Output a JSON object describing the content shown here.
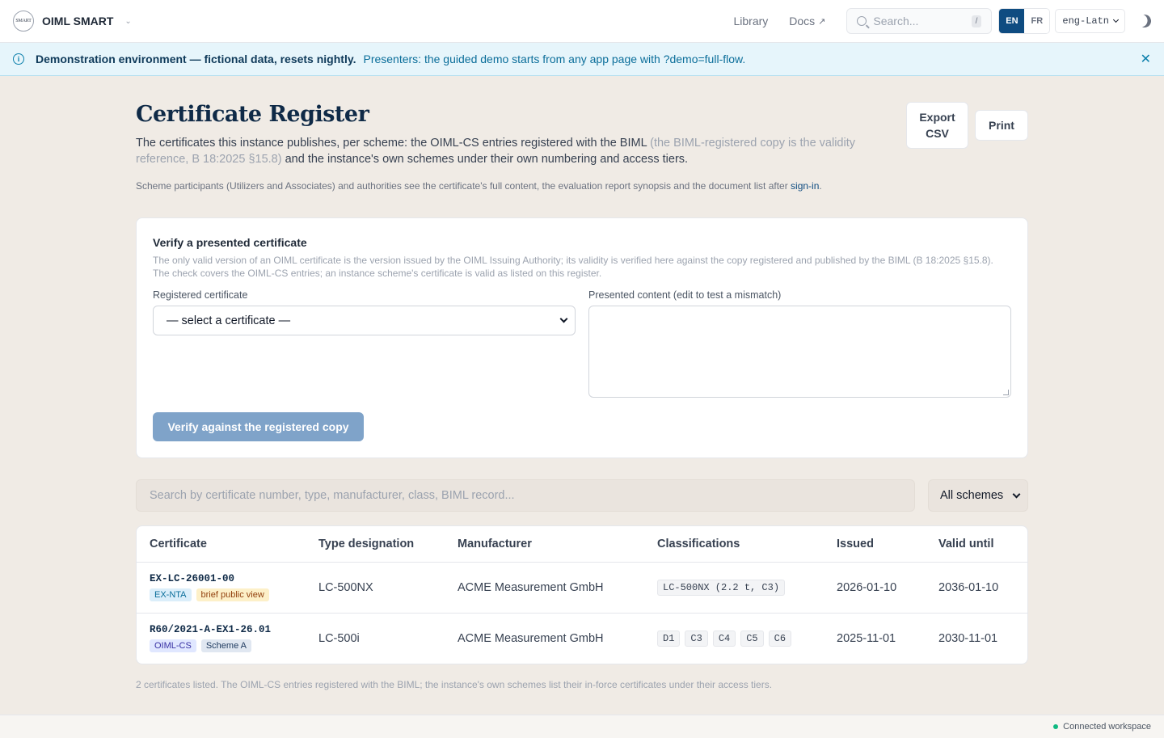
{
  "topbar": {
    "logo_text": "SMART",
    "brand": "OIML SMART",
    "nav": [
      {
        "label": "Library"
      },
      {
        "label": "Docs"
      }
    ],
    "search_placeholder": "Search...",
    "search_shortcut": "/",
    "languages": [
      {
        "label": "EN",
        "active": true
      },
      {
        "label": "FR",
        "active": false
      }
    ],
    "script_select": "eng-Latn"
  },
  "banner": {
    "strong": "Demonstration environment — fictional data, resets nightly.",
    "text": "Presenters: the guided demo starts from any app page with ?demo=full-flow."
  },
  "page": {
    "title": "Certificate Register",
    "lead_1": "The certificates this instance publishes, per scheme: the OIML-CS entries registered with the BIML ",
    "lead_muted": "(the BIML-registered copy is the validity reference, B 18:2025 §15.8)",
    "lead_2": " and the instance's own schemes under their own numbering and access tiers.",
    "fine": "Scheme participants (Utilizers and Associates) and authorities see the certificate's full content, the evaluation report synopsis and the document list after ",
    "fine_link": "sign-in",
    "fine_end": ".",
    "export_label": "Export CSV",
    "print_label": "Print"
  },
  "verify": {
    "title": "Verify a presented certificate",
    "desc": "The only valid version of an OIML certificate is the version issued by the OIML Issuing Authority; its validity is verified here against the copy registered and published by the BIML (B 18:2025 §15.8). The check covers the OIML-CS entries; an instance scheme's certificate is valid as listed on this register.",
    "registered_label": "Registered certificate",
    "registered_value": "— select a certificate —",
    "presented_label": "Presented content (edit to test a mismatch)",
    "button": "Verify against the registered copy"
  },
  "filter": {
    "placeholder": "Search by certificate number, type, manufacturer, class, BIML record...",
    "scheme": "All schemes"
  },
  "table": {
    "headers": [
      "Certificate",
      "Type designation",
      "Manufacturer",
      "Classifications",
      "Issued",
      "Valid until"
    ],
    "rows": [
      {
        "number": "EX-LC-26001-00",
        "tags": [
          "EX-NTA",
          "brief public view"
        ],
        "type": "LC-500NX",
        "manufacturer": "ACME Measurement GmbH",
        "classes": [
          "LC-500NX (2.2 t, C3)"
        ],
        "issued": "2026-01-10",
        "valid_until": "2036-01-10"
      },
      {
        "number": "R60/2021-A-EX1-26.01",
        "tags": [
          "OIML-CS",
          "Scheme A"
        ],
        "type": "LC-500i",
        "manufacturer": "ACME Measurement GmbH",
        "classes": [
          "D1",
          "C3",
          "C4",
          "C5",
          "C6"
        ],
        "issued": "2025-11-01",
        "valid_until": "2030-11-01"
      }
    ]
  },
  "footnote": "2 certificates listed. The OIML-CS entries registered with the BIML; the instance's own schemes list their in-force certificates under their access tiers.",
  "status": "Connected workspace",
  "colors": {
    "accent": "#0f4c81",
    "banner_bg": "#e6f5fb",
    "page_bg": "#f0ebe5",
    "status_ok": "#10b981"
  }
}
